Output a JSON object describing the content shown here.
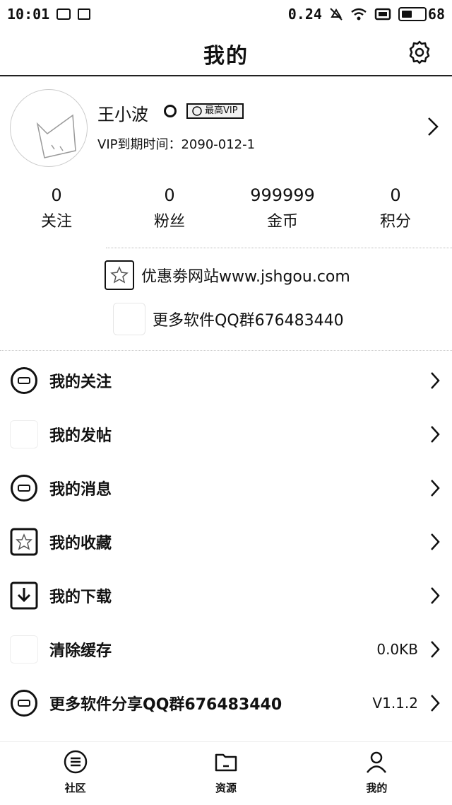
{
  "status_bar": {
    "time": "10:01",
    "network_speed": "0.24",
    "battery": "68"
  },
  "header": {
    "title": "我的",
    "settings_icon": "gear-icon"
  },
  "profile": {
    "name": "王小波",
    "vip_badge": "最高VIP",
    "vip_expire": "VIP到期时间：2090-012-1"
  },
  "stats": [
    {
      "value": "0",
      "label": "关注"
    },
    {
      "value": "0",
      "label": "粉丝"
    },
    {
      "value": "999999",
      "label": "金币"
    },
    {
      "value": "0",
      "label": "积分"
    }
  ],
  "promo": [
    {
      "text": "优惠劵网站www.jshgou.com"
    },
    {
      "text": "更多软件QQ群676483440"
    }
  ],
  "menu": [
    {
      "label": "我的关注",
      "value": ""
    },
    {
      "label": "我的发帖",
      "value": ""
    },
    {
      "label": "我的消息",
      "value": ""
    },
    {
      "label": "我的收藏",
      "value": ""
    },
    {
      "label": "我的下载",
      "value": ""
    },
    {
      "label": "清除缓存",
      "value": "0.0KB"
    },
    {
      "label": "更多软件分享QQ群676483440",
      "value": "V1.1.2"
    }
  ],
  "bottom_nav": [
    {
      "label": "社区",
      "icon": "list-icon"
    },
    {
      "label": "资源",
      "icon": "folder-icon"
    },
    {
      "label": "我的",
      "icon": "user-icon",
      "active": true
    }
  ]
}
